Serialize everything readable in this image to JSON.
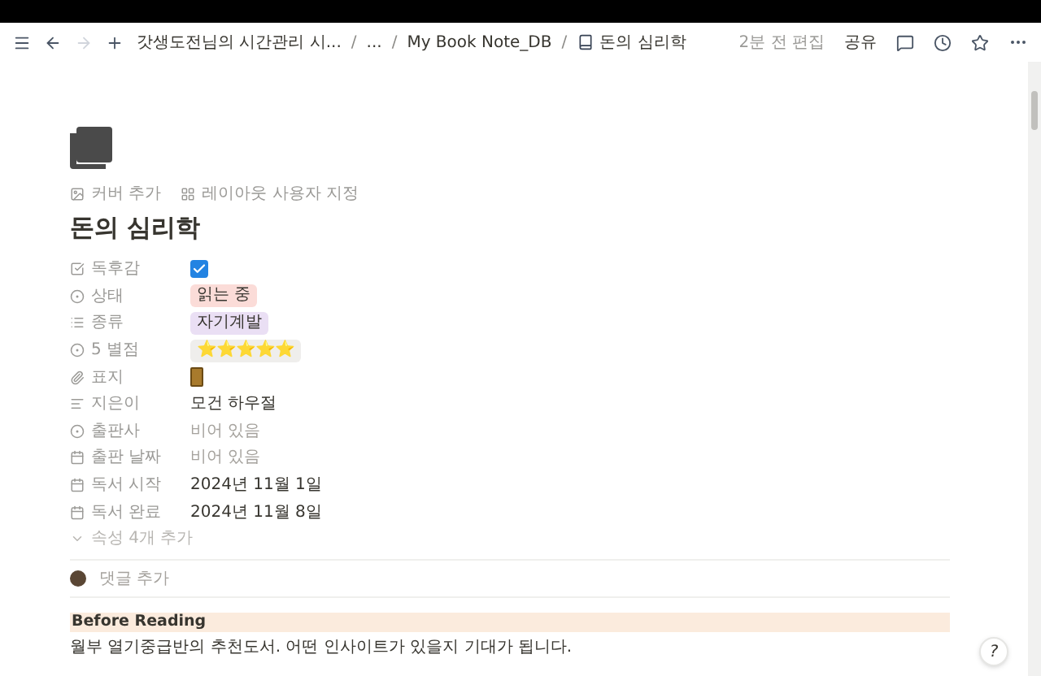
{
  "topbar": {
    "breadcrumbs": [
      "갓생도전님의 시간관리 시...",
      "...",
      "My Book Note_DB",
      "돈의 심리학"
    ],
    "separator": "/",
    "edited": "2분 전 편집",
    "share": "공유"
  },
  "page": {
    "actions": [
      "커버 추가",
      "레이아웃 사용자 지정"
    ],
    "title": "돈의 심리학"
  },
  "properties": [
    {
      "label": "독후감",
      "kind": "checkbox",
      "checked": true
    },
    {
      "label": "상태",
      "kind": "tag",
      "value": "읽는 중",
      "color": "#fbdcd8"
    },
    {
      "label": "종류",
      "kind": "tag",
      "value": "자기계발",
      "color": "#eadff4"
    },
    {
      "label": "5 별점",
      "kind": "tag",
      "value": "⭐⭐⭐⭐⭐",
      "color": "#efeeec"
    },
    {
      "label": "표지",
      "kind": "file"
    },
    {
      "label": "지은이",
      "kind": "text",
      "value": "모건 하우절"
    },
    {
      "label": "출판사",
      "kind": "empty",
      "value": "비어 있음"
    },
    {
      "label": "출판 날짜",
      "kind": "empty",
      "value": "비어 있음"
    },
    {
      "label": "독서 시작",
      "kind": "text",
      "value": "2024년 11월 1일"
    },
    {
      "label": "독서 완료",
      "kind": "text",
      "value": "2024년 11월 8일"
    }
  ],
  "more_properties": "속성 4개 추가",
  "comment": {
    "placeholder": "댓글 추가"
  },
  "callout": {
    "heading": "Before Reading"
  },
  "paragraph": "월부 열기중급반의 추천도서. 어떤 인사이트가 있을지 기대가 됩니다.",
  "help": "?"
}
